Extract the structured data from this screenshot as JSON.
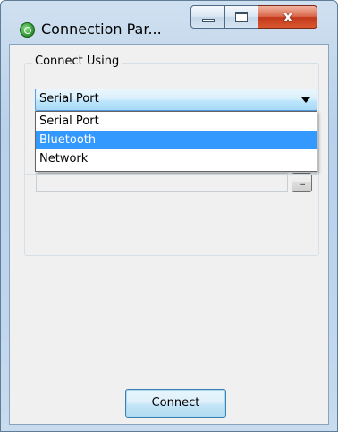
{
  "window": {
    "title": "Connection Par...",
    "icon": "green-circle-app-icon",
    "close_glyph": "x",
    "accent_color": "#3399ff"
  },
  "connect_using": {
    "legend": "Connect Using",
    "selected_value": "Serial Port",
    "options": [
      {
        "label": "Serial Port",
        "highlighted": false
      },
      {
        "label": "Bluetooth",
        "highlighted": true
      },
      {
        "label": "Network",
        "highlighted": false
      }
    ]
  },
  "settings": {
    "path_value": "",
    "browse_label": "..."
  },
  "footer": {
    "connect_label": "Connect"
  }
}
